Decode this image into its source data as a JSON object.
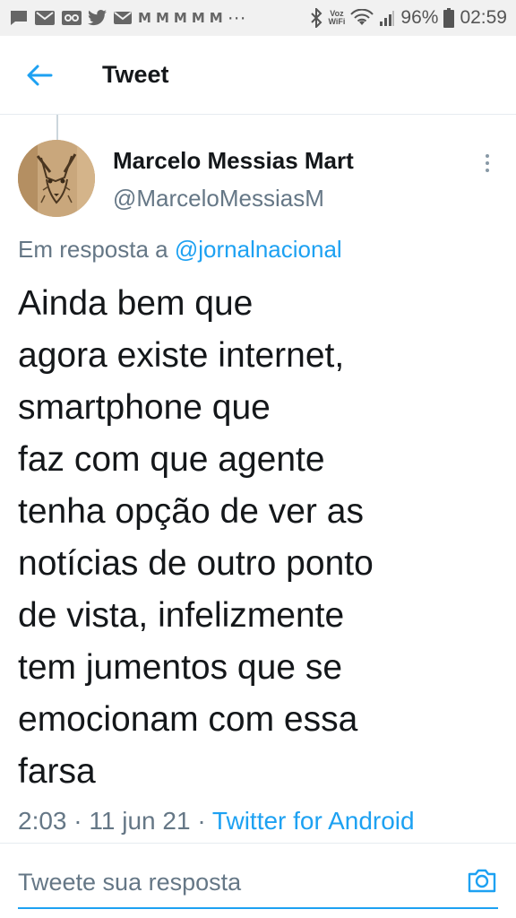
{
  "status_bar": {
    "time": "02:59",
    "battery": "96%",
    "voz_label": "Voz",
    "wifi_label": "WiFi",
    "ellipsis": "···",
    "mail_letters": [
      "M",
      "M",
      "M",
      "M",
      "M"
    ]
  },
  "header": {
    "title": "Tweet"
  },
  "tweet": {
    "author_name": "Marcelo Messias Mart",
    "author_handle": "@MarceloMessiasM",
    "reply_prefix": "Em resposta a ",
    "reply_to": "@jornalnacional",
    "text": "Ainda bem que\nagora existe internet,\nsmartphone que\nfaz com que agente\ntenha opção de ver as\nnotícias de outro ponto\nde vista, infelizmente\ntem jumentos que se\nemocionam com essa\nfarsa",
    "time": "2:03",
    "date": "11 jun 21",
    "separator": "·",
    "source": "Twitter for Android"
  },
  "reply_box": {
    "placeholder": "Tweete sua resposta"
  },
  "colors": {
    "accent": "#1da1f2",
    "secondary_text": "#657786",
    "primary_text": "#14171a"
  }
}
